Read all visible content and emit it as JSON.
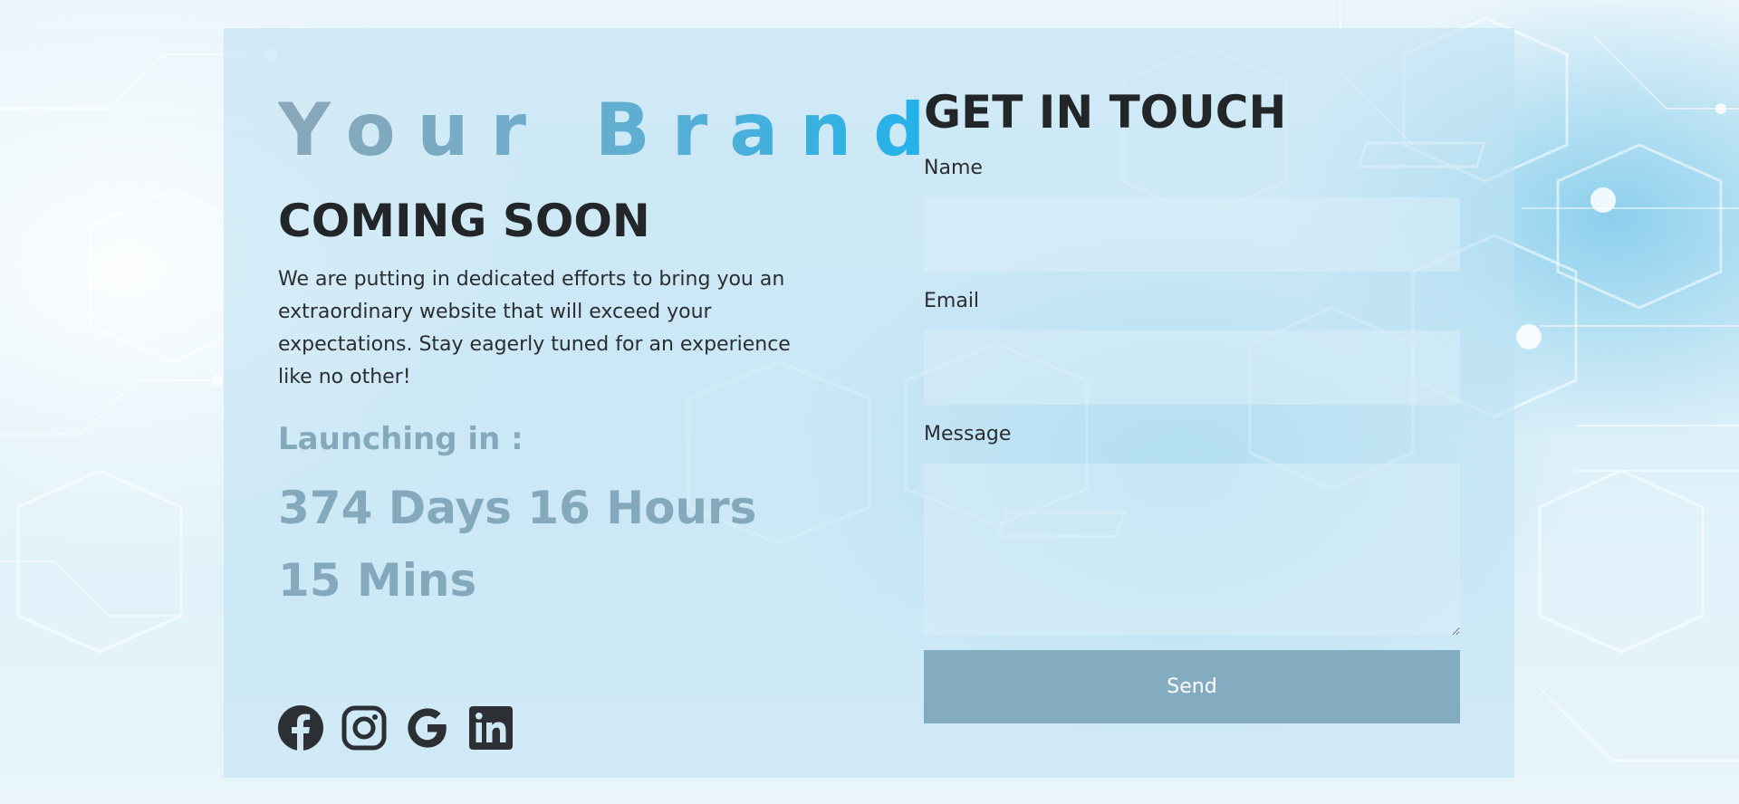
{
  "brand": {
    "name": "Your Brand"
  },
  "hero": {
    "heading": "COMING SOON",
    "description": "We are putting in dedicated efforts to bring you an extraordinary website that will exceed your expectations. Stay eagerly tuned for an experience like no other!",
    "launch_label": "Launching in :",
    "countdown": "374 Days 16 Hours 15 Mins"
  },
  "social": {
    "icons": [
      "facebook-icon",
      "instagram-icon",
      "google-icon",
      "linkedin-icon"
    ]
  },
  "contact": {
    "heading": "GET IN TOUCH",
    "name_label": "Name",
    "name_value": "",
    "email_label": "Email",
    "email_value": "",
    "message_label": "Message",
    "message_value": "",
    "send_label": "Send"
  },
  "colors": {
    "accent": "#84acc0",
    "brand_gradient_start": "#8aa7b7",
    "brand_gradient_end": "#1eb2ec",
    "heading": "#222629",
    "countdown": "#84a9bd"
  }
}
